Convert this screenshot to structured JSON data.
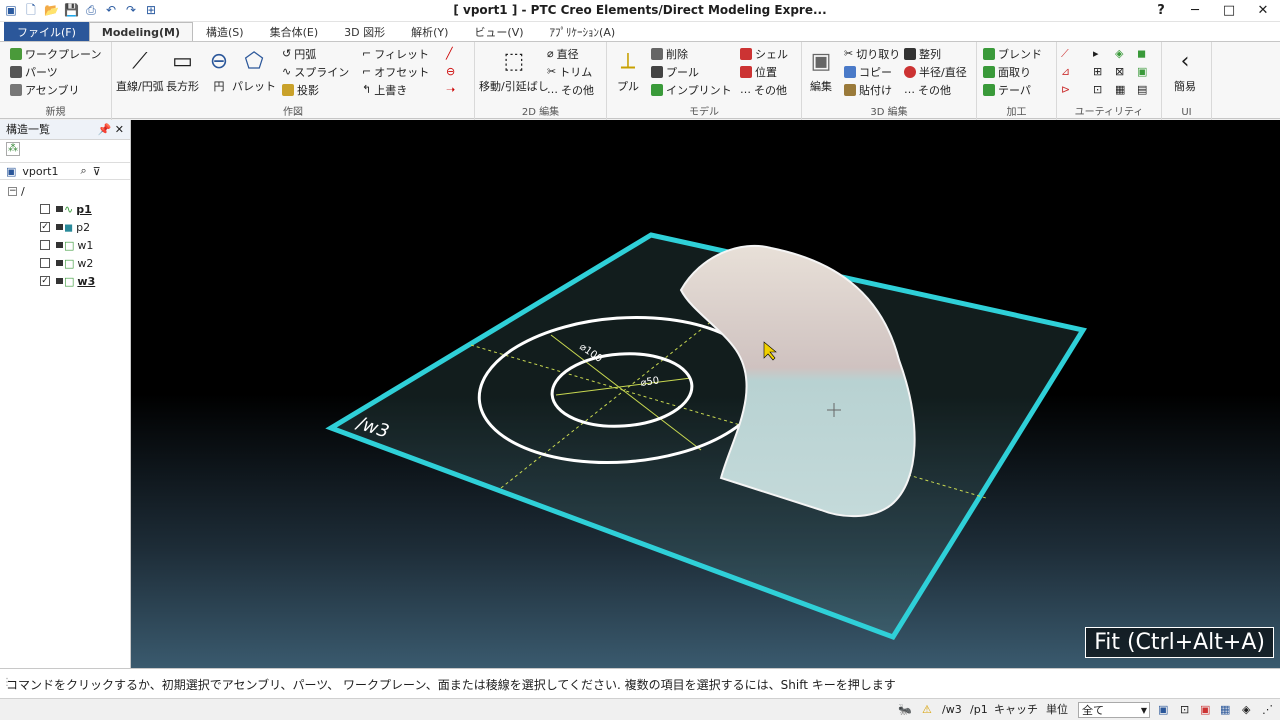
{
  "window": {
    "title": "[ vport1 ] - PTC Creo Elements/Direct Modeling Expre...",
    "minimize": "─",
    "maximize": "□",
    "close": "✕",
    "help": "?"
  },
  "tabs": [
    "ファイル(F)",
    "Modeling(M)",
    "構造(S)",
    "集合体(E)",
    "3D 図形",
    "解析(Y)",
    "ビュー(V)",
    "ｱﾌﾟﾘｹｰｼｮﾝ(A)"
  ],
  "ribbon": {
    "shinki": {
      "title": "新規",
      "items": [
        "ワークプレーン",
        "パーツ",
        "アセンブリ"
      ]
    },
    "sakuzu": {
      "title": "作図",
      "big": [
        "直線/円弧",
        "長方形",
        "円",
        "パレット"
      ],
      "col1": [
        "円弧",
        "スプライン",
        "投影"
      ],
      "col2": [
        "フィレット",
        "オフセット",
        "上書き"
      ]
    },
    "edit2d": {
      "title": "2D 編集",
      "big": "移動/引延ばし",
      "col": [
        "直径",
        "トリム",
        "その他"
      ]
    },
    "model": {
      "title": "モデル",
      "big": "プル",
      "col": [
        "削除",
        "プール",
        "インプリント"
      ]
    },
    "edit3d": {
      "title": "3D 編集",
      "col1": [
        "シェル",
        "位置",
        "その他"
      ],
      "big": "編集",
      "col2": [
        "切り取り",
        "コピー",
        "貼付け"
      ],
      "col3": [
        "整列",
        "半径/直径",
        "その他"
      ]
    },
    "kakou": {
      "title": "加工",
      "col": [
        "ブレンド",
        "面取り",
        "テーパ"
      ]
    },
    "utility": {
      "title": "ユーティリティ"
    },
    "ui": {
      "title": "UI",
      "big": "簡易"
    }
  },
  "panel": {
    "title": "構造一覧",
    "vport": "vport1",
    "tree": [
      {
        "label": "p1",
        "checked": false
      },
      {
        "label": "p2",
        "checked": true
      },
      {
        "label": "w1",
        "checked": false
      },
      {
        "label": "w2",
        "checked": false
      },
      {
        "label": "w3",
        "checked": true
      }
    ]
  },
  "viewport": {
    "fit_label": "Fit (Ctrl+Alt+A)",
    "wp_label": "/w3",
    "dim_outer": "⌀100",
    "dim_inner": "⌀50"
  },
  "status": {
    "prompt": "コマンドをクリックするか、初期選択でアセンブリ、パーツ、 ワークプレーン、面または稜線を選択してください. 複数の項目を選択するには、Shift キーを押します",
    "wp": "/w3",
    "part": "/p1",
    "catch": "キャッチ",
    "unit": "単位",
    "filter": "全て"
  },
  "colors": {
    "accent": "#2b579a",
    "workplane_edge": "#2fd0d8"
  }
}
